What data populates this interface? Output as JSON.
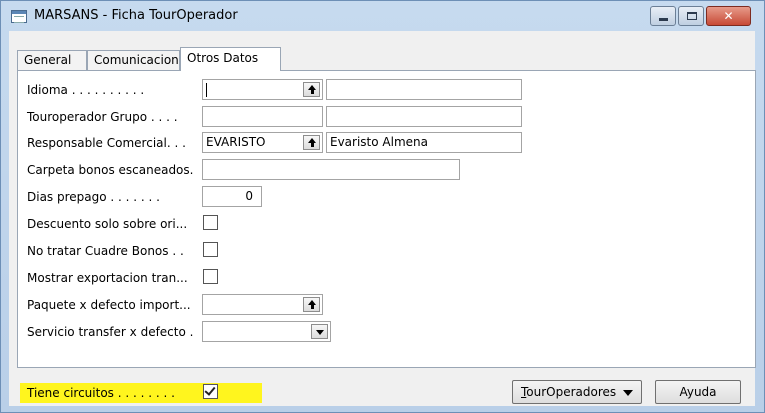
{
  "window": {
    "title": "MARSANS - Ficha TourOperador",
    "controls": {
      "minimize": "minimize",
      "maximize": "maximize",
      "close": "close"
    }
  },
  "tabs": [
    {
      "label": "General",
      "active": false
    },
    {
      "label": "Comunicacion",
      "active": false
    },
    {
      "label": "Otros Datos",
      "active": true
    }
  ],
  "form": {
    "idioma": {
      "label": "Idioma . . . . . . . . . .",
      "code": "",
      "description": ""
    },
    "touroperador_grupo": {
      "label": "Touroperador Grupo . . . .",
      "code": "",
      "description": ""
    },
    "responsable_comercial": {
      "label": "Responsable Comercial. . .",
      "code": "EVARISTO",
      "description": "Evaristo Almena"
    },
    "carpeta_bonos": {
      "label": "Carpeta bonos escaneados.",
      "value": ""
    },
    "dias_prepago": {
      "label": "Dias prepago . . . . . . .",
      "value": "0"
    },
    "descuento_solo": {
      "label": "Descuento solo sobre ori...",
      "checked": false
    },
    "no_tratar_cuadre": {
      "label": "No tratar Cuadre Bonos . .",
      "checked": false
    },
    "mostrar_exportacion": {
      "label": "Mostrar exportacion tran...",
      "checked": false
    },
    "paquete_defecto": {
      "label": "Paquete x defecto import...",
      "value": ""
    },
    "servicio_transfer": {
      "label": "Servicio transfer x defecto .",
      "value": ""
    },
    "tiene_circuitos": {
      "label": "Tiene circuitos . . . . . . . .",
      "checked": true,
      "highlight_color": "#fff51e"
    }
  },
  "buttons": {
    "touroperadores": {
      "underlined_letter": "T",
      "rest": "ourOperadores"
    },
    "ayuda": "Ayuda"
  },
  "icons": [
    "app-form-icon",
    "lookup-arrow-icon",
    "dropdown-arrow-icon",
    "check-icon"
  ]
}
